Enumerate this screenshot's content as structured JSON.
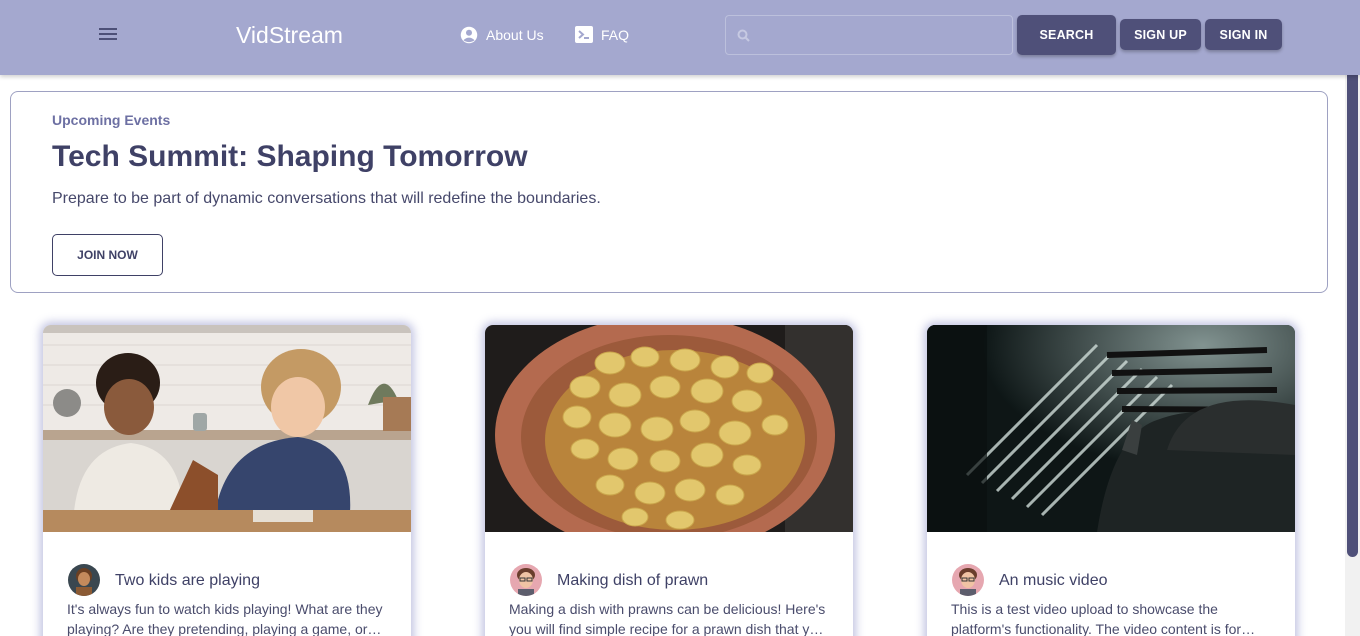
{
  "header": {
    "brand": "VidStream",
    "nav": [
      {
        "label": "About Us",
        "icon": "account-circle-icon"
      },
      {
        "label": "FAQ",
        "icon": "terminal-icon"
      }
    ],
    "search": {
      "placeholder": "",
      "value": "",
      "button": "SEARCH"
    },
    "signup": "SIGN UP",
    "signin": "SIGN IN"
  },
  "banner": {
    "label": "Upcoming Events",
    "title": "Tech Summit: Shaping Tomorrow",
    "description": "Prepare to be part of dynamic conversations that will redefine the boundaries.",
    "button": "JOIN NOW"
  },
  "videos": [
    {
      "title": "Two kids are playing",
      "description": "It's always fun to watch kids playing! What are they playing? Are they pretending, playing a game, or building something together? Watch and find out."
    },
    {
      "title": "Making dish of prawn",
      "description": "Making a dish with prawns can be delicious! Here's you will find simple recipe for a prawn dish that you can easily make at home."
    },
    {
      "title": "An music video",
      "description": "This is a test video upload to showcase the platform's functionality. The video content is for demonstration purposes only."
    }
  ],
  "colors": {
    "header_bg": "#a4a8cf",
    "button_dark": "#4f5079",
    "text_primary": "#3f4166",
    "accent_label": "#6d70a3"
  }
}
